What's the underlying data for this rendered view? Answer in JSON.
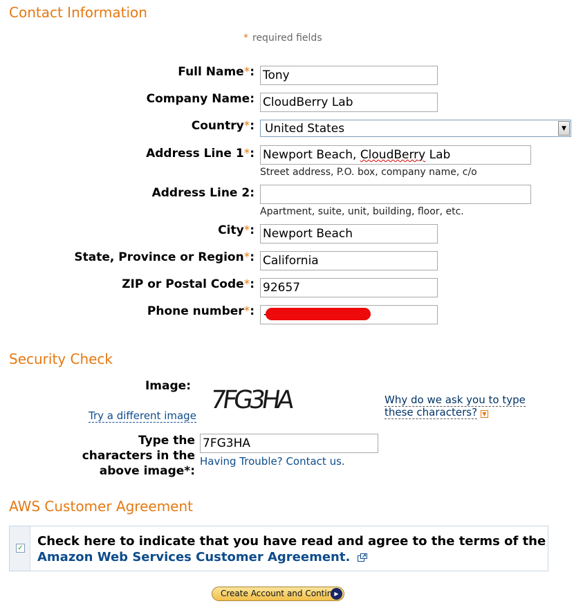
{
  "contact": {
    "title": "Contact Information",
    "required_star": "*",
    "required_note": "required fields",
    "fields": {
      "full_name": {
        "label": "Full Name",
        "value": "Tony"
      },
      "company": {
        "label": "Company Name:",
        "value": "CloudBerry Lab"
      },
      "country": {
        "label": "Country",
        "value": "United States"
      },
      "address1": {
        "label": "Address Line 1",
        "value": "Newport Beach, CloudBerry Lab",
        "hint": "Street address, P.O. box, company name, c/o"
      },
      "address2": {
        "label": "Address Line 2:",
        "value": "",
        "hint": "Apartment, suite, unit, building, floor, etc."
      },
      "city": {
        "label": "City",
        "value": "Newport Beach"
      },
      "state": {
        "label": "State, Province or Region",
        "value": "California"
      },
      "zip": {
        "label": "ZIP or Postal Code",
        "value": "92657"
      },
      "phone": {
        "label": "Phone number",
        "value": "+"
      }
    }
  },
  "security": {
    "title": "Security Check",
    "image_label": "Image:",
    "captcha_text": "7FG3HA",
    "try_different": "Try a different image",
    "why_line1": "Why do we ask you to type",
    "why_line2": "these characters?",
    "type_label_line1": "Type the",
    "type_label_line2": "characters in the",
    "type_label_line3": "above image*:",
    "input_value": "7FG3HA",
    "trouble_link": "Having Trouble? Contact us."
  },
  "agreement": {
    "title": "AWS Customer Agreement",
    "checked": true,
    "text": "Check here to indicate that you have read and agree to the terms of the",
    "link": "Amazon Web Services Customer Agreement."
  },
  "cta": {
    "label": "Create Account and Continue"
  },
  "icons": {
    "select_arrow": "chevron-down-icon",
    "why_toggle": "expand-icon",
    "external_link": "external-link-icon",
    "cta_go": "arrow-right-circle-icon"
  },
  "colors": {
    "heading": "#e47911",
    "link": "#0e4c8c",
    "required": "#e47911"
  }
}
